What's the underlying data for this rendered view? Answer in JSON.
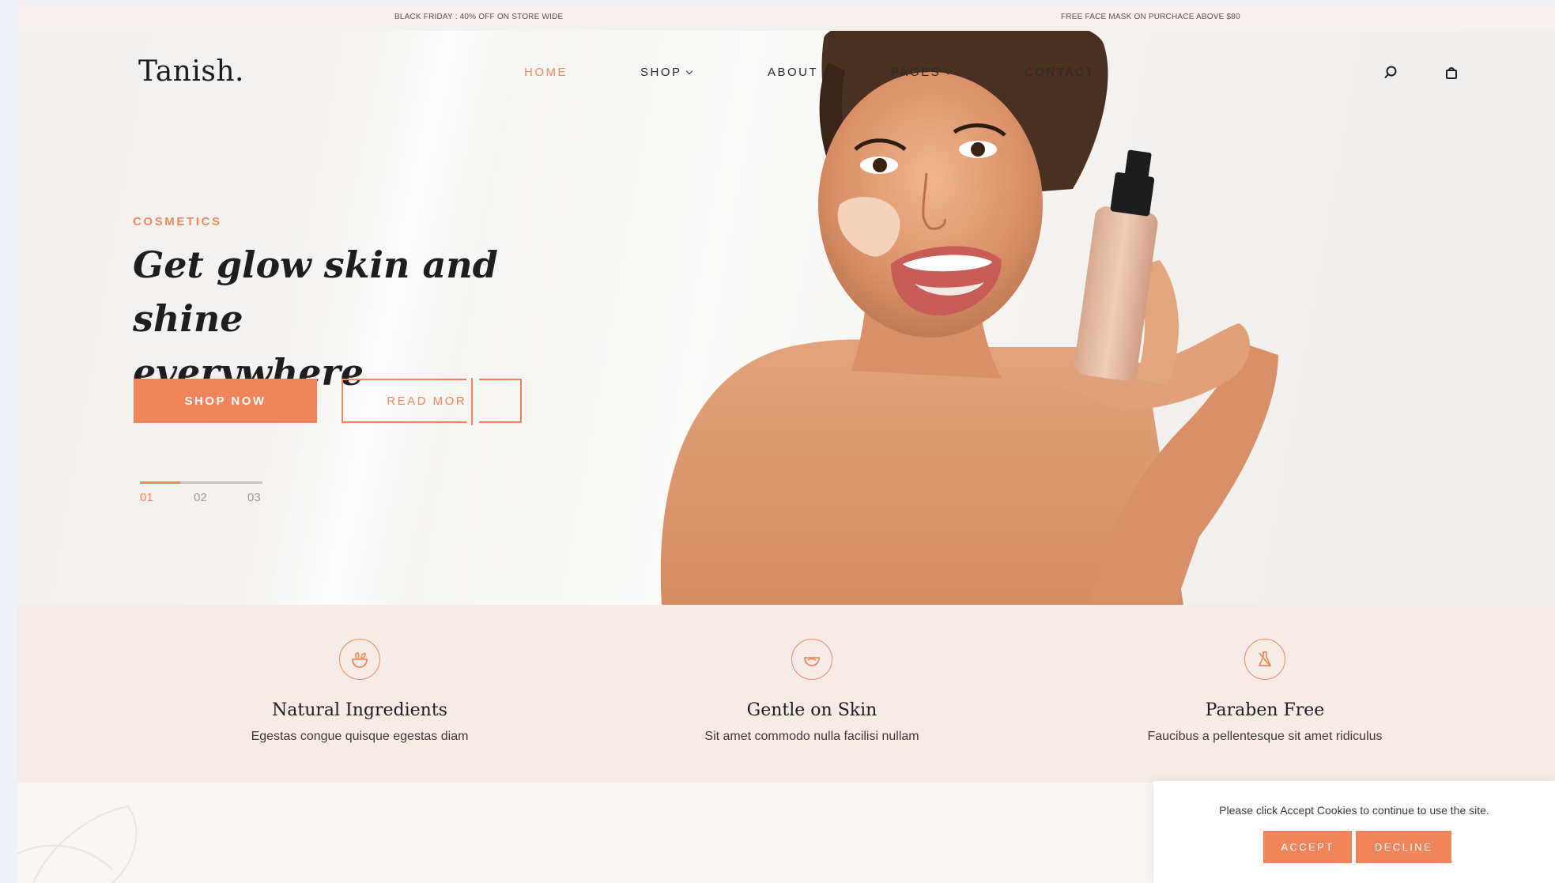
{
  "announcement": {
    "left": "BLACK FRIDAY : 40% OFF ON STORE WIDE",
    "right": "FREE FACE MASK ON PURCHACE ABOVE $80"
  },
  "header": {
    "brand": "Tanish.",
    "nav": [
      {
        "label": "HOME"
      },
      {
        "label": "SHOP"
      },
      {
        "label": "ABOUT"
      },
      {
        "label": "PAGES"
      },
      {
        "label": "CONTACT"
      }
    ],
    "icons": [
      "search-icon",
      "shopping-bag-icon"
    ]
  },
  "hero": {
    "eyebrow": "COSMETICS",
    "headline_line1": "Get glow skin and shine",
    "headline_line2": "everywhere",
    "primary_button": "SHOP NOW",
    "secondary_button": "READ MORE",
    "slides": [
      "01",
      "02",
      "03"
    ],
    "active_slide": 1,
    "slide_progress": 0.33
  },
  "features": [
    {
      "icon": "bowl-of-herbs-icon",
      "title": "Natural Ingredients",
      "desc": "Egestas congue quisque egestas diam"
    },
    {
      "icon": "leaf-in-bowl-icon",
      "title": "Gentle on Skin",
      "desc": "Sit amet commodo nulla facilisi nullam"
    },
    {
      "icon": "no-chemical-flask-icon",
      "title": "Paraben Free",
      "desc": "Faucibus a pellentesque sit amet ridiculus"
    }
  ],
  "cookie": {
    "message": "Please click Accept Cookies to continue to use the site.",
    "accept": "ACCEPT",
    "decline": "DECLINE"
  },
  "colors": {
    "accent": "#f0845a",
    "feature_band": "#f5ece7",
    "text_dark": "#1e1e1e"
  }
}
